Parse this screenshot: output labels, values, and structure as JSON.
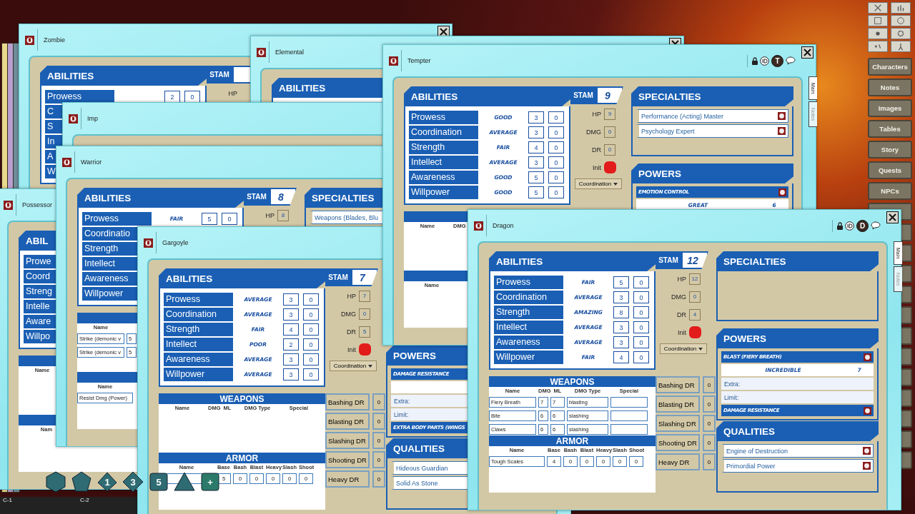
{
  "windows": [
    {
      "title": "Zombie",
      "abilities": {
        "title": "ABILITIES",
        "rows": [
          {
            "name": "Prowess",
            "scores": [
              "2",
              "0"
            ]
          },
          {
            "name": "C"
          },
          {
            "name": "S"
          },
          {
            "name": "In"
          },
          {
            "name": "A"
          },
          {
            "name": "W"
          }
        ]
      },
      "stam": {
        "label": "STAM",
        "stats": [
          {
            "label": "HP"
          }
        ]
      }
    },
    {
      "title": "Elemental",
      "abilities": {
        "title": "ABILITIES"
      }
    },
    {
      "title": "Imp"
    },
    {
      "title": "Possessor",
      "abilities": {
        "title": "ABIL",
        "rows": [
          {
            "name": "Prowe"
          },
          {
            "name": "Coord"
          },
          {
            "name": "Streng"
          },
          {
            "name": "Intelle"
          },
          {
            "name": "Aware"
          },
          {
            "name": "Willpo"
          }
        ]
      },
      "weapons": {
        "columns": [
          "Name"
        ]
      },
      "armor": {
        "columns": [
          "Nam"
        ]
      }
    },
    {
      "title": "Warrior",
      "abilities": {
        "title": "ABILITIES",
        "rows": [
          {
            "name": "Prowess",
            "rank": "FAIR",
            "scores": [
              "5",
              "0"
            ]
          },
          {
            "name": "Coordinatio"
          },
          {
            "name": "Strength"
          },
          {
            "name": "Intellect"
          },
          {
            "name": "Awareness"
          },
          {
            "name": "Willpower"
          }
        ]
      },
      "stam": {
        "label": "STAM",
        "value": "8",
        "stats": [
          {
            "label": "HP",
            "value": "8"
          }
        ]
      },
      "specialties": {
        "title": "SPECIALTIES",
        "items": [
          "Weapons (Blades, Blu"
        ]
      },
      "weapons": {
        "columns": [
          "Name"
        ],
        "rows": [
          {
            "name": "Strike (demonic v",
            "dmg": "5"
          },
          {
            "name": "Strike (demonic v",
            "dmg": "5"
          }
        ]
      },
      "armor": {
        "columns": [
          "Name"
        ],
        "rows": [
          {
            "name": "Resist Dmg (Power)"
          }
        ]
      }
    },
    {
      "title": "Gargoyle",
      "abilities": {
        "title": "ABILITIES",
        "rows": [
          {
            "name": "Prowess",
            "rank": "AVERAGE",
            "scores": [
              "3",
              "0"
            ]
          },
          {
            "name": "Coordination",
            "rank": "AVERAGE",
            "scores": [
              "3",
              "0"
            ]
          },
          {
            "name": "Strength",
            "rank": "FAIR",
            "scores": [
              "4",
              "0"
            ]
          },
          {
            "name": "Intellect",
            "rank": "POOR",
            "scores": [
              "2",
              "0"
            ]
          },
          {
            "name": "Awareness",
            "rank": "AVERAGE",
            "scores": [
              "3",
              "0"
            ]
          },
          {
            "name": "Willpower",
            "rank": "AVERAGE",
            "scores": [
              "3",
              "0"
            ]
          }
        ]
      },
      "stam": {
        "label": "STAM",
        "value": "7",
        "stats": [
          {
            "label": "HP",
            "value": "7"
          },
          {
            "label": "DMG",
            "value": "0"
          },
          {
            "label": "DR",
            "value": "5"
          }
        ],
        "init": "Init",
        "init_skill": "Coordination"
      },
      "weapons": {
        "title": "WEAPONS",
        "columns": [
          "Name",
          "DMG",
          "ML",
          "DMG Type",
          "Special"
        ]
      },
      "armor": {
        "title": "ARMOR",
        "columns": [
          "Name",
          "Base",
          "Bash",
          "Blast",
          "Heavy",
          "Slash",
          "Shoot"
        ],
        "rows": [
          {
            "values": [
              "5",
              "0",
              "0",
              "0",
              "0",
              "0"
            ]
          }
        ]
      },
      "dr": [
        {
          "label": "Bashing DR",
          "value": "0"
        },
        {
          "label": "Blasting DR",
          "value": "0"
        },
        {
          "label": "Slashing DR",
          "value": "0"
        },
        {
          "label": "Shooting DR",
          "value": "0"
        },
        {
          "label": "Heavy DR",
          "value": "0"
        }
      ],
      "powers": {
        "title": "POWERS",
        "items": [
          {
            "name": "DAMAGE RESISTANCE",
            "details": [
              "Extra:",
              "Limit:"
            ]
          },
          {
            "name": "EXTRA BODY PARTS (WINGS"
          }
        ]
      },
      "qualities": {
        "title": "QUALITIES",
        "items": [
          "Hideous Guardian",
          "Solid As Stone"
        ]
      }
    },
    {
      "title": "Tempter",
      "token": "T",
      "tabs": [
        {
          "label": "Main",
          "selected": true
        },
        {
          "label": "Notes",
          "selected": false
        }
      ],
      "abilities": {
        "title": "ABILITIES",
        "rows": [
          {
            "name": "Prowess",
            "rank": "GOOD",
            "scores": [
              "3",
              "0"
            ]
          },
          {
            "name": "Coordination",
            "rank": "AVERAGE",
            "scores": [
              "3",
              "0"
            ]
          },
          {
            "name": "Strength",
            "rank": "FAIR",
            "scores": [
              "4",
              "0"
            ]
          },
          {
            "name": "Intellect",
            "rank": "AVERAGE",
            "scores": [
              "3",
              "0"
            ]
          },
          {
            "name": "Awareness",
            "rank": "GOOD",
            "scores": [
              "5",
              "0"
            ]
          },
          {
            "name": "Willpower",
            "rank": "GOOD",
            "scores": [
              "5",
              "0"
            ]
          }
        ]
      },
      "stam": {
        "label": "STAM",
        "value": "9",
        "stats": [
          {
            "label": "HP",
            "value": "9"
          },
          {
            "label": "DMG",
            "value": "0"
          },
          {
            "label": "DR",
            "value": "0"
          }
        ],
        "init": "Init",
        "init_skill": "Coordination"
      },
      "specialties": {
        "title": "SPECIALTIES",
        "items": [
          "Performance (Acting) Master",
          "Psychology Expert"
        ]
      },
      "powers": {
        "title": "POWERS",
        "items": [
          {
            "name": "EMOTION CONTROL",
            "rank": "GREAT",
            "value": "6"
          }
        ]
      },
      "weapons": {
        "columns": [
          "Name",
          "DMG"
        ]
      },
      "armor": {
        "columns": [
          "Name"
        ]
      }
    },
    {
      "title": "Dragon",
      "token": "D",
      "tabs": [
        {
          "label": "Main",
          "selected": true
        },
        {
          "label": "Notes",
          "selected": false
        }
      ],
      "abilities": {
        "title": "ABILITIES",
        "rows": [
          {
            "name": "Prowess",
            "rank": "FAIR",
            "scores": [
              "5",
              "0"
            ]
          },
          {
            "name": "Coordination",
            "rank": "AVERAGE",
            "scores": [
              "3",
              "0"
            ]
          },
          {
            "name": "Strength",
            "rank": "AMAZING",
            "scores": [
              "8",
              "0"
            ]
          },
          {
            "name": "Intellect",
            "rank": "AVERAGE",
            "scores": [
              "3",
              "0"
            ]
          },
          {
            "name": "Awareness",
            "rank": "AVERAGE",
            "scores": [
              "3",
              "0"
            ]
          },
          {
            "name": "Willpower",
            "rank": "FAIR",
            "scores": [
              "4",
              "0"
            ]
          }
        ]
      },
      "stam": {
        "label": "STAM",
        "value": "12",
        "stats": [
          {
            "label": "HP",
            "value": "12"
          },
          {
            "label": "DMG",
            "value": "0"
          },
          {
            "label": "DR",
            "value": "4"
          }
        ],
        "init": "Init",
        "init_skill": "Coordination"
      },
      "specialties": {
        "title": "SPECIALTIES"
      },
      "powers": {
        "title": "POWERS",
        "items": [
          {
            "name": "BLAST (FIERY BREATH)",
            "rank": "INCREDIBLE",
            "value": "7",
            "details": [
              "Extra:",
              "Limit:"
            ]
          },
          {
            "name": "DAMAGE RESISTANCE"
          }
        ]
      },
      "qualities": {
        "title": "QUALITIES",
        "items": [
          "Engine of Destruction",
          "Primordial Power"
        ]
      },
      "weapons": {
        "title": "WEAPONS",
        "columns": [
          "Name",
          "DMG",
          "ML",
          "DMG Type",
          "Special"
        ],
        "rows": [
          {
            "name": "Fiery Breath",
            "dmg": "7",
            "ml": "7",
            "type": "blasting"
          },
          {
            "name": "Bite",
            "dmg": "6",
            "ml": "6",
            "type": "slashing"
          },
          {
            "name": "Claws",
            "dmg": "6",
            "ml": "6",
            "type": "slashing"
          }
        ]
      },
      "armor": {
        "title": "ARMOR",
        "columns": [
          "Name",
          "Base",
          "Bash",
          "Blast",
          "Heavy",
          "Slash",
          "Shoot"
        ],
        "rows": [
          {
            "name": "Tough Scales",
            "values": [
              "4",
              "0",
              "0",
              "0",
              "0",
              "0"
            ]
          }
        ]
      },
      "dr": [
        {
          "label": "Bashing DR",
          "value": "0"
        },
        {
          "label": "Blasting DR",
          "value": "0"
        },
        {
          "label": "Slashing DR",
          "value": "0"
        },
        {
          "label": "Shooting DR",
          "value": "0"
        },
        {
          "label": "Heavy DR",
          "value": "0"
        }
      ]
    }
  ],
  "sidebar": {
    "buttons": [
      "Characters",
      "Notes",
      "Images",
      "Tables",
      "Story",
      "Quests",
      "NPCs"
    ]
  },
  "dice": [
    {
      "kind": "d20"
    },
    {
      "kind": "d12"
    },
    {
      "kind": "d10",
      "face": "1"
    },
    {
      "kind": "d8",
      "face": "3"
    },
    {
      "kind": "d6",
      "face": "5"
    },
    {
      "kind": "d4"
    },
    {
      "kind": "add",
      "face": "+"
    }
  ],
  "hotkeys": [
    "C-1",
    "C-2"
  ]
}
